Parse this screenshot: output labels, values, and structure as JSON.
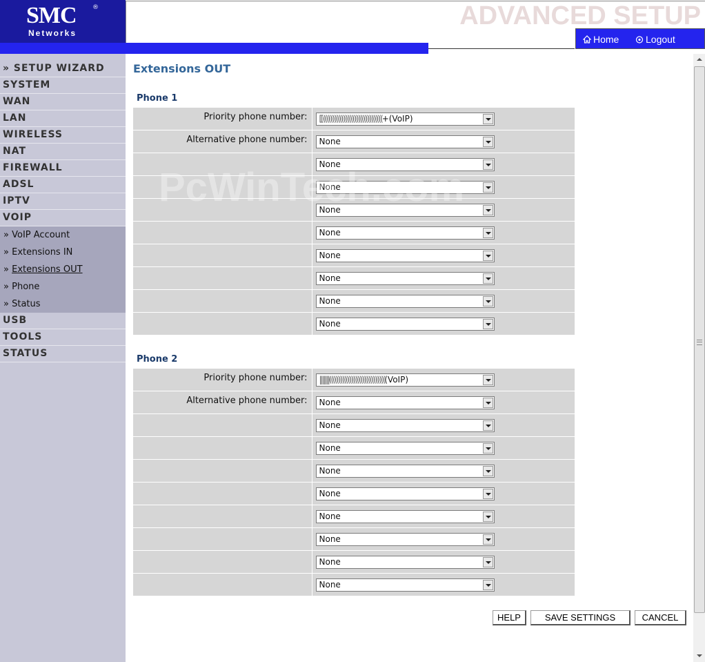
{
  "header": {
    "logo_text": "SMC",
    "logo_reg": "®",
    "logo_sub": "Networks",
    "title": "ADVANCED SETUP",
    "home_label": "Home",
    "logout_label": "Logout"
  },
  "sidebar": {
    "items_top": [
      {
        "label": "» SETUP WIZARD"
      },
      {
        "label": "SYSTEM"
      },
      {
        "label": "WAN"
      },
      {
        "label": "LAN"
      },
      {
        "label": "WIRELESS"
      },
      {
        "label": "NAT"
      },
      {
        "label": "FIREWALL"
      },
      {
        "label": "ADSL"
      },
      {
        "label": "IPTV"
      },
      {
        "label": "VOIP"
      }
    ],
    "sub_items": [
      {
        "label": "VoIP Account",
        "prefix": "»"
      },
      {
        "label": "Extensions IN",
        "prefix": "»"
      },
      {
        "label": "Extensions OUT",
        "prefix": "»",
        "active": true
      },
      {
        "label": "Phone",
        "prefix": "»"
      },
      {
        "label": "Status",
        "prefix": "»"
      }
    ],
    "items_bottom": [
      {
        "label": "USB"
      },
      {
        "label": "TOOLS"
      },
      {
        "label": "STATUS"
      }
    ]
  },
  "main": {
    "page_title": "Extensions OUT",
    "watermark": "PcWinTech.com",
    "phone1": {
      "title": "Phone 1",
      "priority_label": "Priority phone number:",
      "alternative_label": "Alternative phone number:",
      "priority_value_masked": "[[((((((((((((((((((((((((((((((((",
      "priority_value_suffix": "+(VoIP)",
      "alternatives": [
        "None",
        "None",
        "None",
        "None",
        "None",
        "None",
        "None",
        "None",
        "None"
      ]
    },
    "phone2": {
      "title": "Phone 2",
      "priority_label": "Priority phone number:",
      "alternative_label": "Alternative phone number:",
      "priority_value_masked": "|||||||((((((((((((((((((((((((((((((",
      "priority_value_suffix": "(VoIP)",
      "alternatives": [
        "None",
        "None",
        "None",
        "None",
        "None",
        "None",
        "None",
        "None",
        "None"
      ]
    },
    "buttons": {
      "help": "HELP",
      "save": "SAVE SETTINGS",
      "cancel": "CANCEL"
    }
  },
  "colors": {
    "brand_blue": "#1a1a9e",
    "bar_blue": "#2424ee",
    "sidebar_bg": "#c8c8d8",
    "submenu_bg": "#a6a6bc",
    "title_color": "#336699",
    "row_bg": "#d6d6d6"
  }
}
